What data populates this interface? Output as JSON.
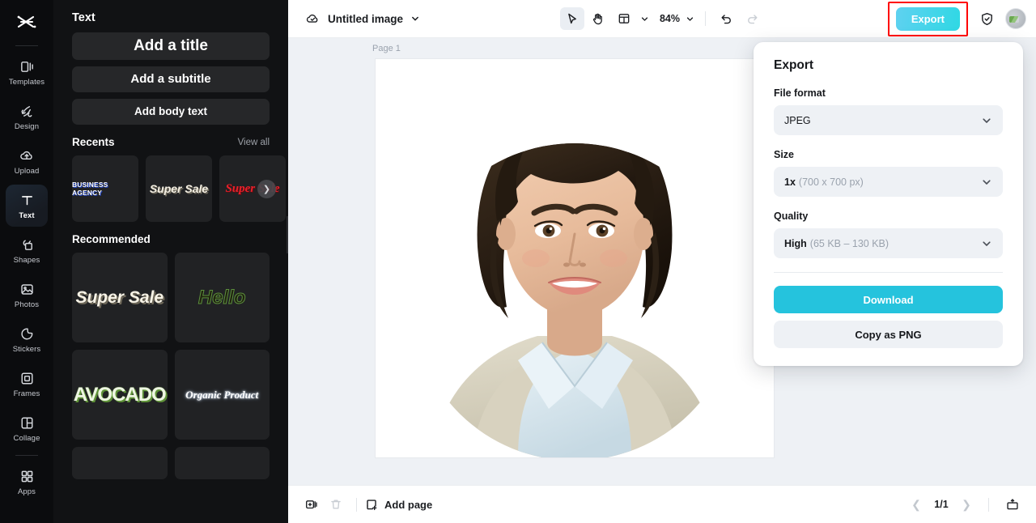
{
  "rail": {
    "logo_icon": "capcut-logo-icon",
    "items": [
      {
        "label": "Templates",
        "icon": "templates-icon",
        "active": false
      },
      {
        "label": "Design",
        "icon": "design-icon",
        "active": false
      },
      {
        "label": "Upload",
        "icon": "upload-cloud-icon",
        "active": false
      },
      {
        "label": "Text",
        "icon": "text-icon",
        "active": true
      },
      {
        "label": "Shapes",
        "icon": "shapes-icon",
        "active": false
      },
      {
        "label": "Photos",
        "icon": "photos-icon",
        "active": false
      },
      {
        "label": "Stickers",
        "icon": "stickers-icon",
        "active": false
      },
      {
        "label": "Frames",
        "icon": "frames-icon",
        "active": false
      },
      {
        "label": "Collage",
        "icon": "collage-icon",
        "active": false
      },
      {
        "label": "Apps",
        "icon": "apps-icon",
        "active": false
      }
    ]
  },
  "panel": {
    "title": "Text",
    "add_title": "Add a title",
    "add_subtitle": "Add a subtitle",
    "add_body": "Add body text",
    "recents_heading": "Recents",
    "view_all": "View all",
    "recents": [
      {
        "label": "BUSINESS AGENCY"
      },
      {
        "label": "Super Sale"
      },
      {
        "label": "Super Sale"
      }
    ],
    "recommended_heading": "Recommended",
    "recommended": [
      {
        "label": "Super Sale"
      },
      {
        "label": "Hello"
      },
      {
        "label": "AVOCADO"
      },
      {
        "label": "Organic Product"
      },
      {
        "label": ""
      },
      {
        "label": ""
      }
    ]
  },
  "topbar": {
    "cloud_icon": "cloud-saved-icon",
    "doc_title": "Untitled image",
    "doc_caret_icon": "chevron-down-icon",
    "select_tool_icon": "cursor-select-icon",
    "hand_tool_icon": "hand-pan-icon",
    "layout_tool_icon": "layout-panels-icon",
    "layout_caret_icon": "chevron-down-icon",
    "zoom_value": "84%",
    "zoom_caret_icon": "chevron-down-icon",
    "undo_icon": "undo-icon",
    "redo_icon": "redo-icon",
    "export_label": "Export",
    "shield_icon": "shield-check-icon",
    "avatar_icon": "user-avatar"
  },
  "canvas": {
    "page_label": "Page 1",
    "artwork": "portrait-photo-woman-smiling"
  },
  "bottombar": {
    "duplicate_icon": "duplicate-page-icon",
    "delete_icon": "trash-icon",
    "add_page_icon": "add-page-icon",
    "add_page_label": "Add page",
    "prev_icon": "chevron-left-icon",
    "page_count": "1/1",
    "next_icon": "chevron-right-icon",
    "present_icon": "present-icon"
  },
  "export_panel": {
    "title": "Export",
    "file_format_label": "File format",
    "file_format_value": "JPEG",
    "size_label": "Size",
    "size_value_bold": "1x",
    "size_value_muted": "(700 x 700 px)",
    "quality_label": "Quality",
    "quality_value_bold": "High",
    "quality_value_muted": "(65 KB – 130 KB)",
    "download_label": "Download",
    "copy_label": "Copy as PNG",
    "caret_icon": "chevron-down-icon"
  },
  "colors": {
    "accent": "#25c3dd",
    "export_btn_a": "#5fd1f0",
    "export_btn_b": "#2fd8e4",
    "highlight_box": "#ff0000",
    "panel_bg": "#111214",
    "rail_bg": "#0b0c0e",
    "canvas_bg": "#eef1f5"
  }
}
